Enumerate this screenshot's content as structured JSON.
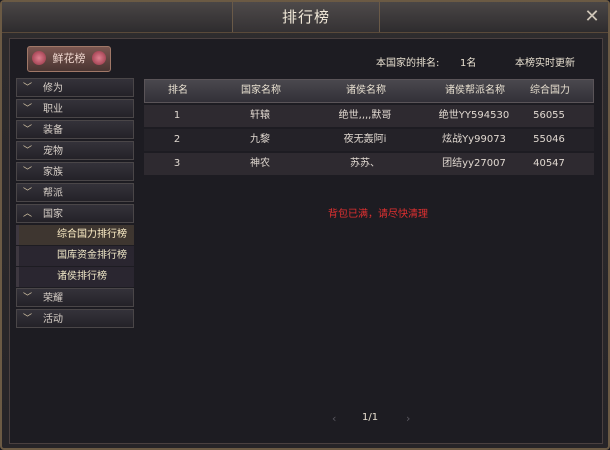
{
  "window": {
    "title": "排行榜",
    "close_icon": "close-icon"
  },
  "sidebar": {
    "flower_button": "鲜花榜",
    "items": [
      {
        "label": "修为",
        "icon": "chevron-down-icon"
      },
      {
        "label": "职业",
        "icon": "chevron-down-icon"
      },
      {
        "label": "装备",
        "icon": "chevron-down-icon"
      },
      {
        "label": "宠物",
        "icon": "chevron-down-icon"
      },
      {
        "label": "家族",
        "icon": "chevron-down-icon"
      },
      {
        "label": "帮派",
        "icon": "chevron-down-icon"
      },
      {
        "label": "国家",
        "icon": "chevron-up-icon"
      }
    ],
    "sub_items": [
      {
        "label": "综合国力排行榜"
      },
      {
        "label": "国库资金排行榜"
      },
      {
        "label": "诸侯排行榜"
      }
    ],
    "items_after": [
      {
        "label": "荣耀",
        "icon": "chevron-down-icon"
      },
      {
        "label": "活动",
        "icon": "chevron-down-icon"
      }
    ]
  },
  "main": {
    "rank_label": "本国家的排名:",
    "rank_value": "1名",
    "update_note": "本榜实时更新",
    "columns": [
      "排名",
      "国家名称",
      "诸侯名称",
      "诸侯帮派名称",
      "综合国力"
    ],
    "rows": [
      [
        "1",
        "轩辕",
        "绝世,,,,默哥",
        "绝世YY594530",
        "56055"
      ],
      [
        "2",
        "九黎",
        "夜无轰阿i",
        "炫战Yy99073",
        "55046"
      ],
      [
        "3",
        "神农",
        "苏苏、",
        "团结yy27007",
        "40547"
      ]
    ],
    "warning": "背包已满，请尽快清理",
    "pager": {
      "current": "1/1",
      "prev_icon": "prev-arrow-icon",
      "next_icon": "next-arrow-icon"
    }
  }
}
